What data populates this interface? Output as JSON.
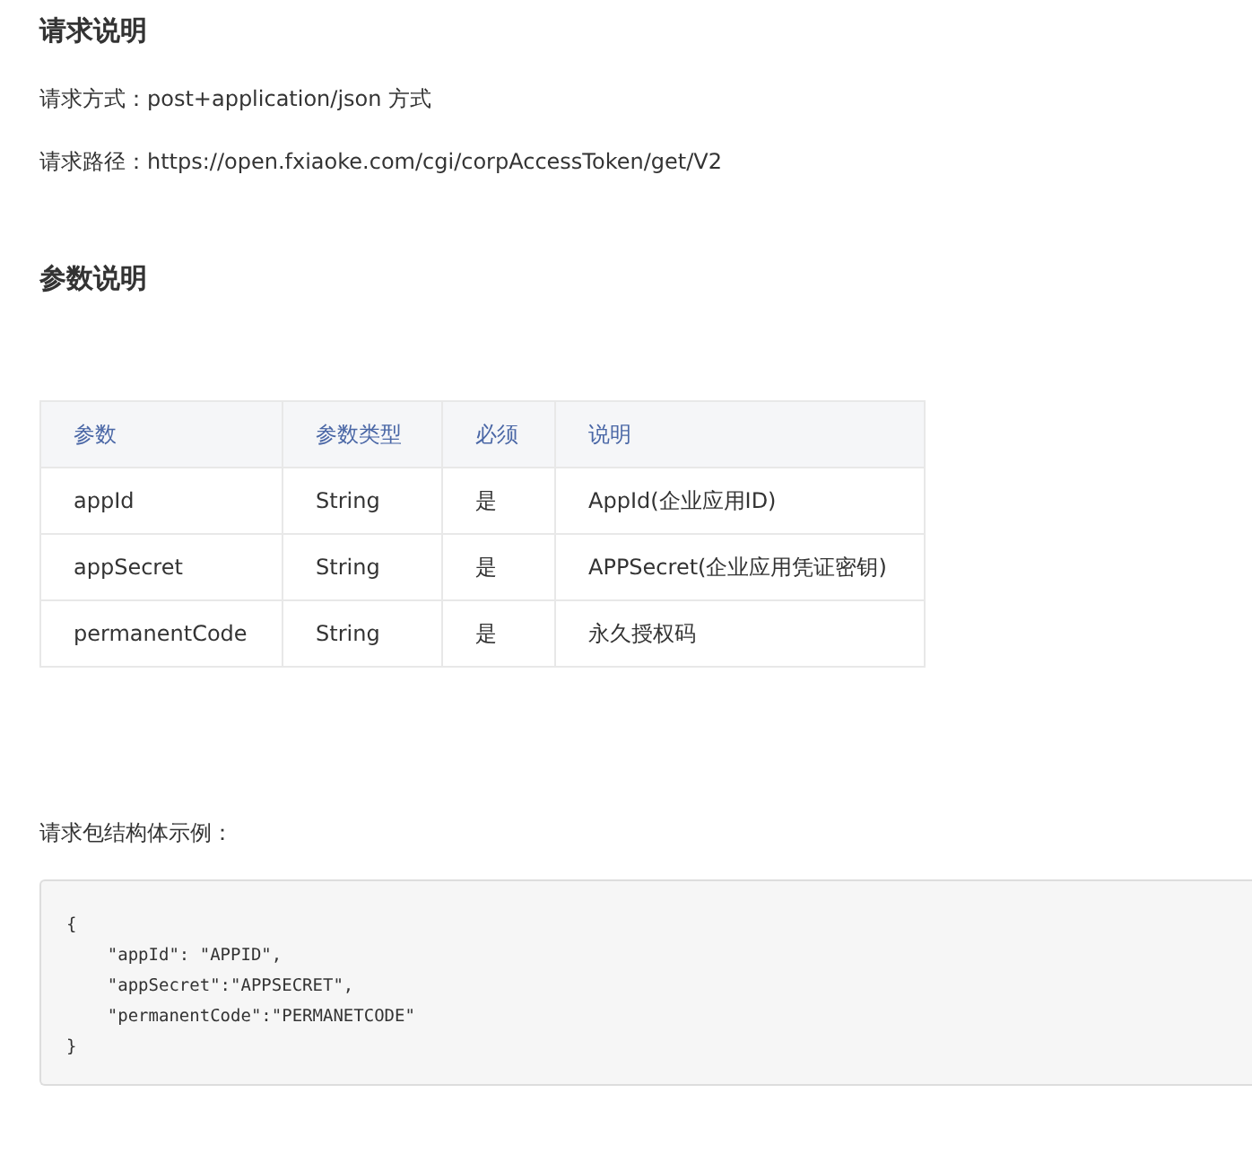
{
  "request_section": {
    "title": "请求说明",
    "lines": [
      "请求方式：post+application/json 方式",
      "请求路径：https://open.fxiaoke.com/cgi/corpAccessToken/get/V2"
    ]
  },
  "params_section": {
    "title": "参数说明",
    "table": {
      "columns": [
        "参数",
        "参数类型",
        "必须",
        "说明"
      ],
      "rows": [
        [
          "appId",
          "String",
          "是",
          "AppId(企业应用ID)"
        ],
        [
          "appSecret",
          "String",
          "是",
          "APPSecret(企业应用凭证密钥)"
        ],
        [
          "permanentCode",
          "String",
          "是",
          "永久授权码"
        ]
      ]
    }
  },
  "example": {
    "label": "请求包结构体示例：",
    "code_lines": [
      "{",
      "    \"appId\": \"APPID\",",
      "    \"appSecret\":\"APPSECRET\",",
      "    \"permanentCode\":\"PERMANETCODE\"",
      "}"
    ]
  }
}
